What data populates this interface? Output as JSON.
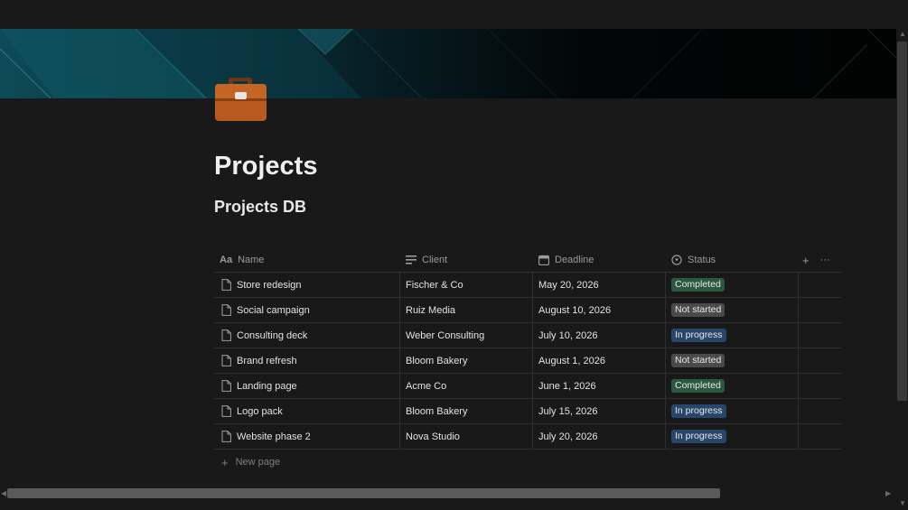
{
  "page": {
    "title": "Projects",
    "icon": "briefcase-icon",
    "database_title": "Projects DB"
  },
  "table": {
    "columns": [
      {
        "label": "Name",
        "icon": "title-property-icon"
      },
      {
        "label": "Client",
        "icon": "text-lines-icon"
      },
      {
        "label": "Deadline",
        "icon": "calendar-icon"
      },
      {
        "label": "Status",
        "icon": "status-icon"
      }
    ],
    "add_column_glyph": "+",
    "more_glyph": "···",
    "rows": [
      {
        "name": "Store redesign",
        "client": "Fischer & Co",
        "deadline": "May 20, 2026",
        "status": "Completed"
      },
      {
        "name": "Social campaign",
        "client": "Ruiz Media",
        "deadline": "August 10, 2026",
        "status": "Not started"
      },
      {
        "name": "Consulting deck",
        "client": "Weber Consulting",
        "deadline": "July 10, 2026",
        "status": "In progress"
      },
      {
        "name": "Brand refresh",
        "client": "Bloom Bakery",
        "deadline": "August 1, 2026",
        "status": "Not started"
      },
      {
        "name": "Landing page",
        "client": "Acme Co",
        "deadline": "June 1, 2026",
        "status": "Completed"
      },
      {
        "name": "Logo pack",
        "client": "Bloom Bakery",
        "deadline": "July 15, 2026",
        "status": "In progress"
      },
      {
        "name": "Website phase 2",
        "client": "Nova Studio",
        "deadline": "July 20, 2026",
        "status": "In progress"
      }
    ],
    "new_page_label": "New page"
  },
  "status_colors": {
    "Completed": "#2b593f",
    "Not started": "#4a4a4a",
    "In progress": "#28456c"
  }
}
